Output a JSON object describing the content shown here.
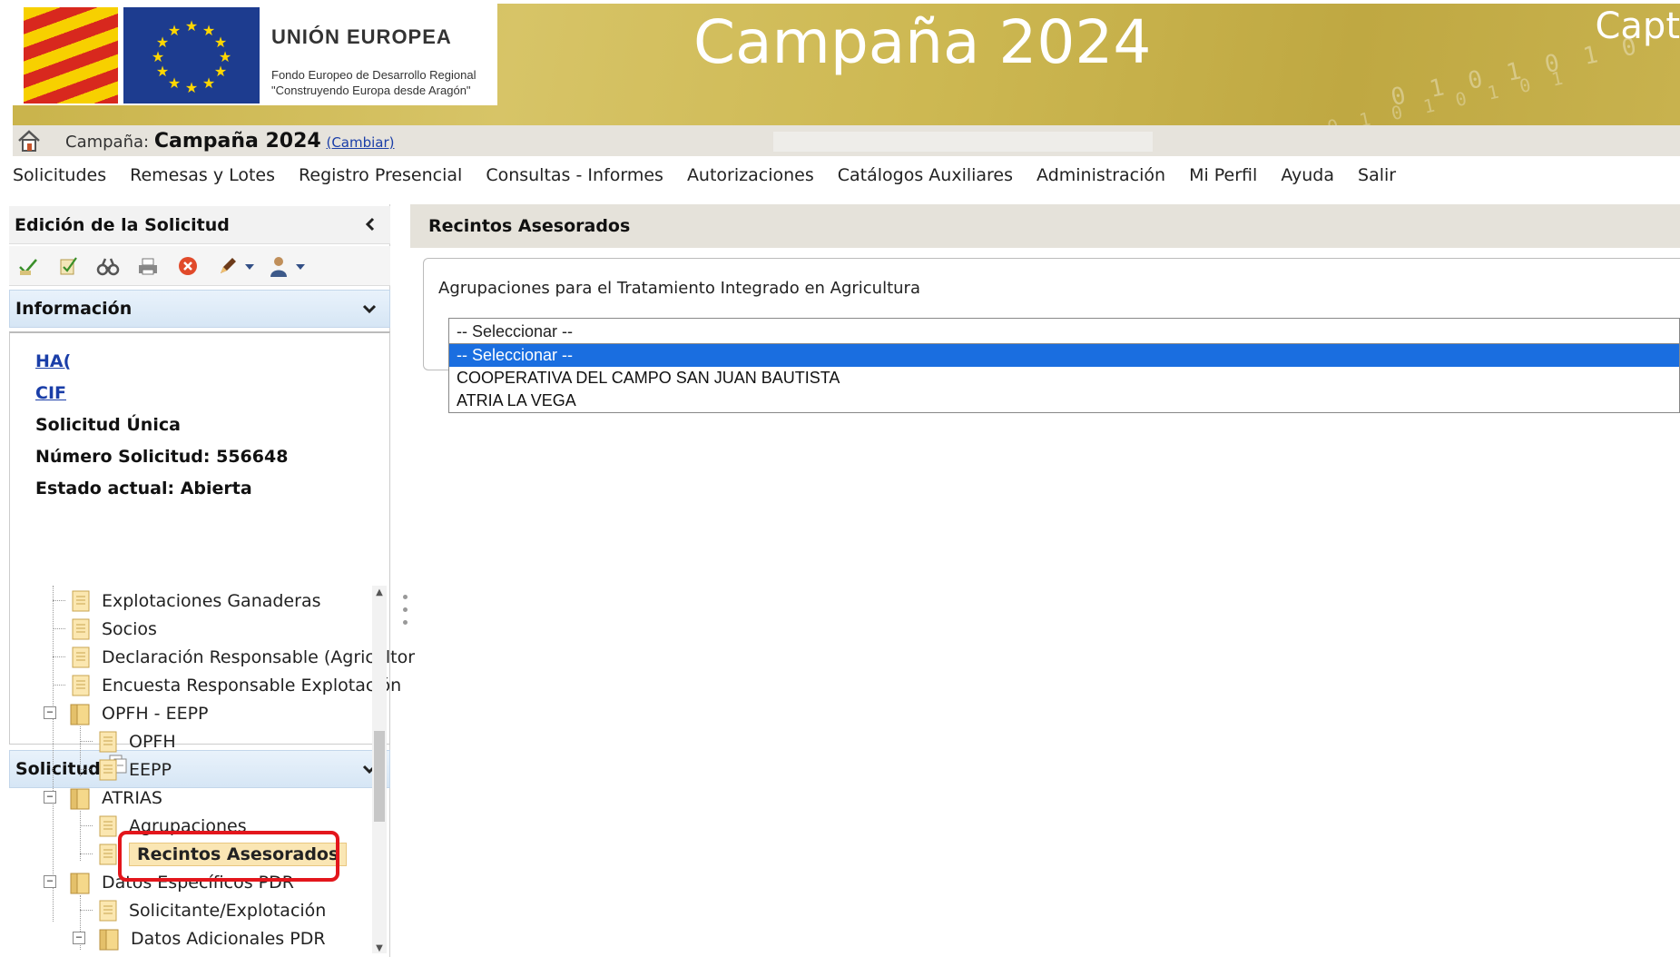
{
  "banner": {
    "eu_title": "UNIÓN EUROPEA",
    "eu_fund": "Fondo Europeo de Desarrollo Regional",
    "eu_motto": "\"Construyendo Europa desde Aragón\"",
    "campaign_title": "Campaña 2024",
    "corner_text": "Capt"
  },
  "campaign_bar": {
    "label": "Campaña:",
    "value": "Campaña 2024",
    "change_link": "(Cambiar)"
  },
  "menu": {
    "items": [
      "Solicitudes",
      "Remesas y Lotes",
      "Registro Presencial",
      "Consultas - Informes",
      "Autorizaciones",
      "Catálogos Auxiliares",
      "Administración",
      "Mi Perfil",
      "Ayuda",
      "Salir"
    ]
  },
  "left_panel": {
    "edit_title": "Edición de la Solicitud",
    "info_title": "Información",
    "info": {
      "link1": "HA(",
      "link2": "CIF",
      "type": "Solicitud Única",
      "number": "Número Solicitud: 556648",
      "state": "Estado actual: Abierta"
    },
    "solicitud_title": "Solicitud",
    "tree": {
      "items": [
        "Explotaciones Ganaderas",
        "Socios",
        "Declaración Responsable (Agricultor",
        "Encuesta Responsable Explotación",
        "OPFH - EEPP",
        "OPFH",
        "EEPP",
        "ATRIAS",
        "Agrupaciones",
        "Recintos Asesorados",
        "Datos Específicos PDR",
        "Solicitante/Explotación",
        "Datos Adicionales PDR"
      ]
    }
  },
  "main": {
    "header": "Recintos Asesorados",
    "field_label": "Agrupaciones para el Tratamiento Integrado en Agricultura",
    "select_value": "-- Seleccionar --",
    "options": [
      "-- Seleccionar --",
      "COOPERATIVA DEL CAMPO SAN JUAN BAUTISTA",
      "ATRIA LA VEGA"
    ]
  },
  "colors": {
    "accent_blue": "#1a6ee0",
    "highlight_red": "#e3161c",
    "banner_gold": "#cdb852"
  }
}
